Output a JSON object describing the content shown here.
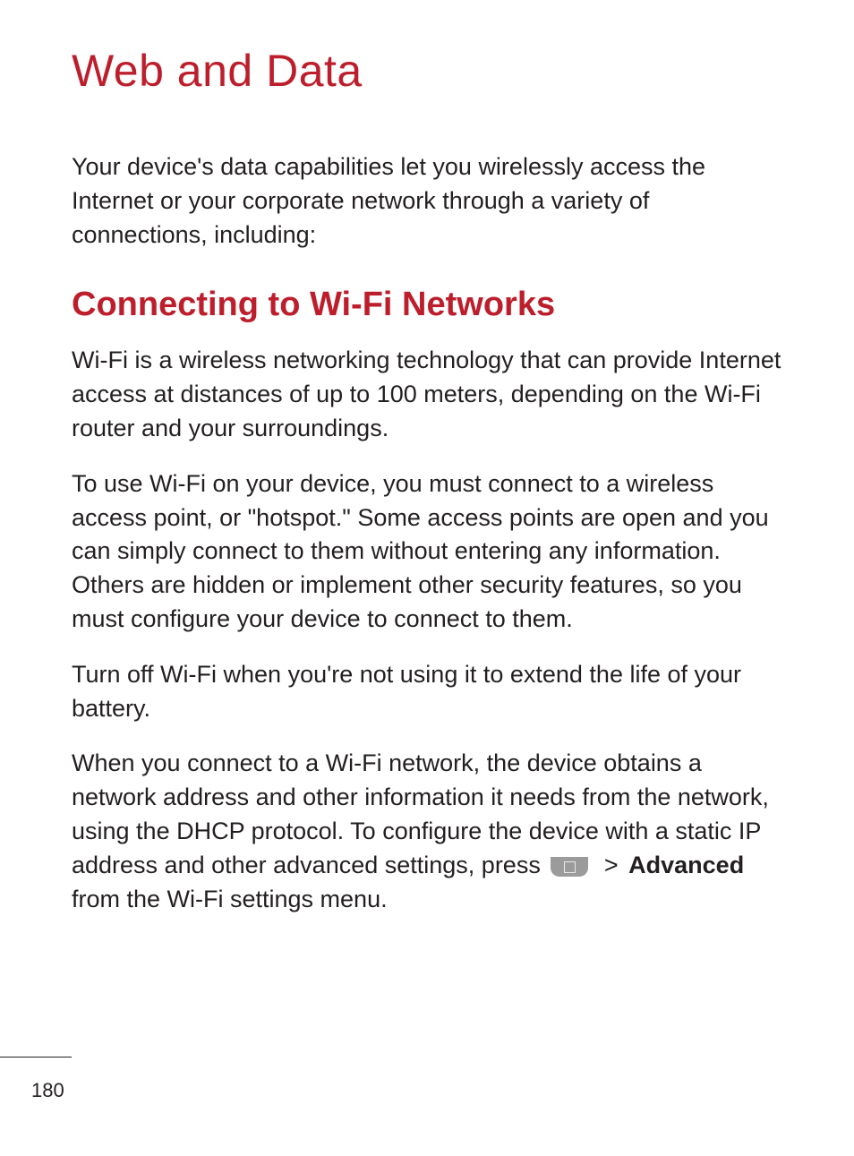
{
  "chapter": {
    "title": "Web and Data"
  },
  "intro": "Your device's data capabilities let you wirelessly access the Internet or your corporate network through a variety of connections, including:",
  "section": {
    "title": "Connecting to Wi-Fi Networks"
  },
  "paragraphs": {
    "p1": "Wi-Fi is a wireless networking technology that can provide Internet access at distances of up to 100 meters, depending on the Wi-Fi router and your surroundings.",
    "p2": "To use Wi-Fi on your device, you must connect to a wireless access point, or \"hotspot.\" Some access points are open and you can simply connect to them without entering any information. Others are hidden or implement other security features, so you must configure your device to connect to them.",
    "p3": "Turn off Wi-Fi when you're not using it to extend the life of your battery.",
    "p4_pre": "When you connect to a Wi-Fi network, the device obtains a network address and other information it needs from the network, using the DHCP protocol. To configure the device with a static IP address and other advanced settings, press ",
    "p4_gt": ">",
    "p4_bold": "Advanced",
    "p4_post": " from the Wi-Fi settings menu."
  },
  "footer": {
    "pageNumber": "180"
  }
}
